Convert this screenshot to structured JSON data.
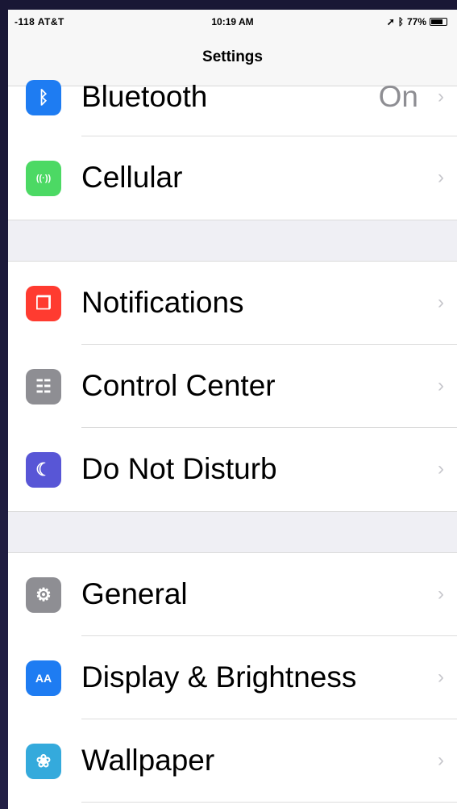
{
  "statusbar": {
    "carrier": "-118 AT&T",
    "time": "10:19 AM",
    "battery": "77%",
    "battery_level": 0.77
  },
  "navbar": {
    "title": "Settings"
  },
  "groups": [
    [
      {
        "label": "Bluetooth",
        "value": "On",
        "icon": "bluetooth-icon",
        "color": "#1e7cf2"
      },
      {
        "label": "Cellular",
        "value": "",
        "icon": "cellular-icon",
        "color": "#4cd964"
      }
    ],
    [
      {
        "label": "Notifications",
        "value": "",
        "icon": "notifications-icon",
        "color": "#ff3b30"
      },
      {
        "label": "Control Center",
        "value": "",
        "icon": "control-center-icon",
        "color": "#8e8e93"
      },
      {
        "label": "Do Not Disturb",
        "value": "",
        "icon": "moon-icon",
        "color": "#5856d6"
      }
    ],
    [
      {
        "label": "General",
        "value": "",
        "icon": "gear-icon",
        "color": "#8e8e93"
      },
      {
        "label": "Display & Brightness",
        "value": "",
        "icon": "display-icon",
        "color": "#1e7cf2"
      },
      {
        "label": "Wallpaper",
        "value": "",
        "icon": "wallpaper-icon",
        "color": "#34aadc"
      }
    ]
  ]
}
